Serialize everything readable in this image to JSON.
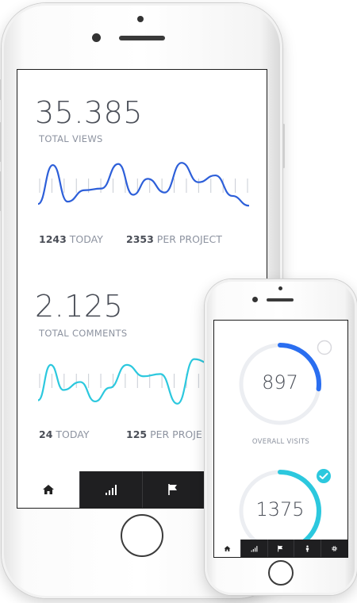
{
  "views": {
    "total": "35.385",
    "label": "TOTAL VIEWS",
    "today_value": "1243",
    "today_label": "TODAY",
    "per_project_value": "2353",
    "per_project_label": "PER PROJECT",
    "color": "#2d5fd9"
  },
  "comments": {
    "total": "2.125",
    "label": "TOTAL COMMENTS",
    "today_value": "24",
    "today_label": "TODAY",
    "per_project_value": "125",
    "per_project_label": "PER PROJE",
    "color": "#2cc8de"
  },
  "visits": {
    "value": "897",
    "label": "OVERALL VISITS",
    "progress": 0.27,
    "color": "#2a6ef0"
  },
  "second_ring": {
    "value": "1375",
    "progress": 0.42,
    "color": "#2cc8de"
  },
  "tabs": [
    "home-icon",
    "signal-icon",
    "flag-icon",
    "person-icon",
    "gear-icon"
  ]
}
